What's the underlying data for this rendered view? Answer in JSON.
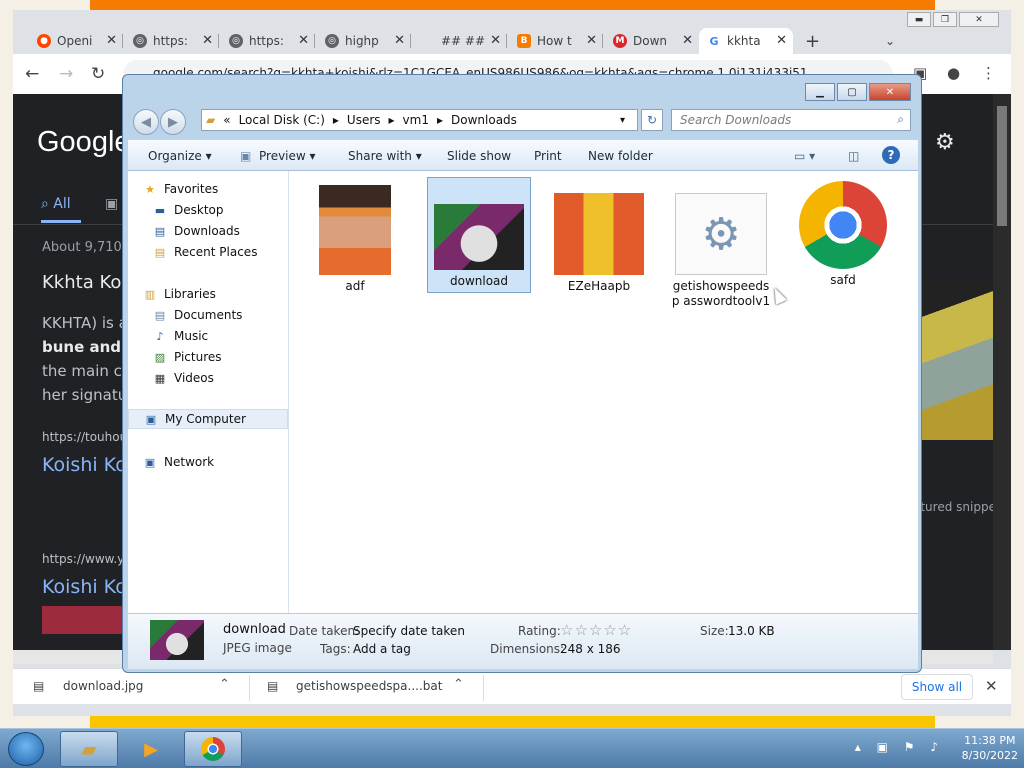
{
  "chrome": {
    "tabs": [
      {
        "label": "Openi",
        "icon": "reddit-icon",
        "color": "#ff4500"
      },
      {
        "label": "https:",
        "icon": "globe-icon",
        "color": "#5f6368"
      },
      {
        "label": "https:",
        "icon": "globe-icon",
        "color": "#5f6368"
      },
      {
        "label": "highp",
        "icon": "globe-icon",
        "color": "#5f6368"
      },
      {
        "label": "## ##",
        "icon": "blank-icon",
        "color": "#dee1e6"
      },
      {
        "label": "How t",
        "icon": "blogger-icon",
        "color": "#f57c00"
      },
      {
        "label": "Down",
        "icon": "mega-icon",
        "color": "#d9272e"
      },
      {
        "label": "kkhta",
        "icon": "google-icon",
        "color": "#4285f4"
      }
    ],
    "new_tab": "+",
    "url": "google.com/search?q=kkhta+koishi&rlz=1C1GCEA_enUS986US986&oq=kkhta&aqs=chrome.1.0i131i433i51..."
  },
  "google": {
    "logo": "Google",
    "tab_all": "All",
    "stats": "About 9,710",
    "heading": "Kkhta Ko",
    "text1": "KKHTA) is a",
    "text2": "bune and u",
    "text3": "the main ch",
    "text4": "her signatu",
    "url1": "https://touhou",
    "link1": "Koishi Ko",
    "url2": "https://www.y",
    "link2": "Koishi Ko",
    "featured": "atured snippe"
  },
  "downloads": {
    "items": [
      {
        "name": "download.jpg"
      },
      {
        "name": "getishowspeedspa....bat"
      }
    ],
    "show_all": "Show all"
  },
  "explorer": {
    "address": [
      "«",
      "Local Disk (C:)",
      "▸",
      "Users",
      "▸",
      "vm1",
      "▸",
      "Downloads"
    ],
    "search_placeholder": "Search Downloads",
    "toolbar": [
      "Organize ▾",
      "Preview ▾",
      "Share with ▾",
      "Slide show",
      "Print",
      "New folder"
    ],
    "nav": {
      "favorites": "Favorites",
      "desktop": "Desktop",
      "downloads": "Downloads",
      "recent": "Recent Places",
      "libraries": "Libraries",
      "documents": "Documents",
      "music": "Music",
      "pictures": "Pictures",
      "videos": "Videos",
      "computer": "My Computer",
      "network": "Network"
    },
    "files": [
      {
        "name": "adf"
      },
      {
        "name": "download"
      },
      {
        "name": "EZeHaapb"
      },
      {
        "name": "getishowspeedsp asswordtoolv1"
      },
      {
        "name": "safd"
      }
    ],
    "details": {
      "name": "download",
      "type": "JPEG image",
      "date_label": "Date taken:",
      "date_value": "Specify date taken",
      "tags_label": "Tags:",
      "tags_value": "Add a tag",
      "rating_label": "Rating:",
      "rating_stars": "☆☆☆☆☆",
      "dimensions_label": "Dimensions:",
      "dimensions_value": "248 x 186",
      "size_label": "Size:",
      "size_value": "13.0 KB"
    }
  },
  "taskbar": {
    "time": "11:38 PM",
    "date": "8/30/2022"
  }
}
